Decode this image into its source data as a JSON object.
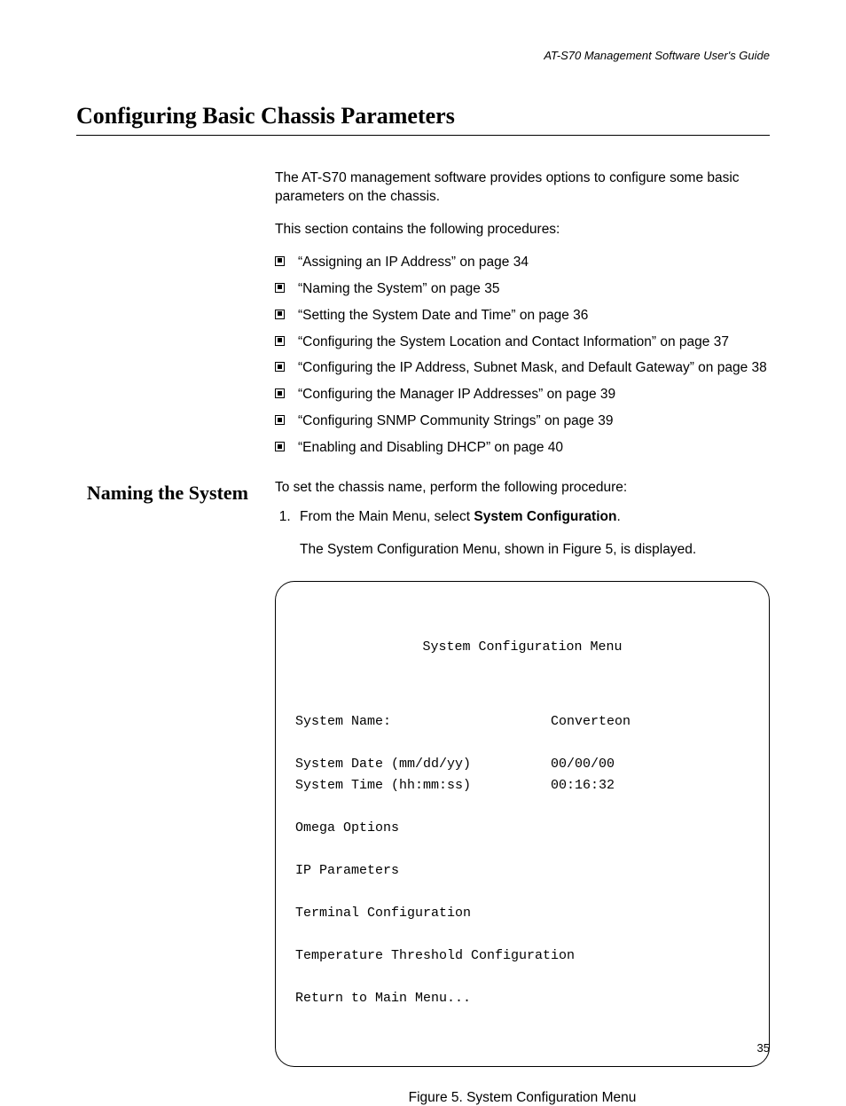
{
  "running_head": "AT-S70 Management Software User's Guide",
  "h1": "Configuring Basic Chassis Parameters",
  "intro_para_1": "The AT-S70 management software provides options to configure some basic parameters on the chassis.",
  "intro_para_2": "This section contains the following procedures:",
  "procedures": [
    "“Assigning an IP Address” on page 34",
    "“Naming the System” on page 35",
    "“Setting the System Date and Time” on page 36",
    "“Configuring the System Location and Contact Information” on page 37",
    "“Configuring the IP Address, Subnet Mask, and Default Gateway” on page 38",
    "“Configuring the Manager IP Addresses” on page 39",
    "“Configuring SNMP Community Strings” on page 39",
    "“Enabling and Disabling DHCP” on page 40"
  ],
  "side_heading": "Naming the System",
  "section_intro": "To set the chassis name, perform the following procedure:",
  "step1_pre": "From the Main Menu, select ",
  "step1_bold": "System Configuration",
  "step1_post": ".",
  "step1_result": "The System Configuration Menu, shown in Figure 5, is displayed.",
  "menu": {
    "title": "System Configuration Menu",
    "rows": [
      {
        "label": "System Name:",
        "value": "Converteon"
      },
      {
        "label": "",
        "value": ""
      },
      {
        "label": "System Date (mm/dd/yy)",
        "value": "00/00/00"
      },
      {
        "label": "System Time (hh:mm:ss)",
        "value": "00:16:32"
      },
      {
        "label": "",
        "value": ""
      },
      {
        "label": "Omega Options",
        "value": ""
      },
      {
        "label": "",
        "value": ""
      },
      {
        "label": "IP Parameters",
        "value": ""
      },
      {
        "label": "",
        "value": ""
      },
      {
        "label": "Terminal Configuration",
        "value": ""
      },
      {
        "label": "",
        "value": ""
      },
      {
        "label": "Temperature Threshold Configuration",
        "value": ""
      },
      {
        "label": "",
        "value": ""
      },
      {
        "label": "Return to Main Menu...",
        "value": ""
      }
    ]
  },
  "figure_caption": "Figure 5. System Configuration Menu",
  "page_number": "35"
}
